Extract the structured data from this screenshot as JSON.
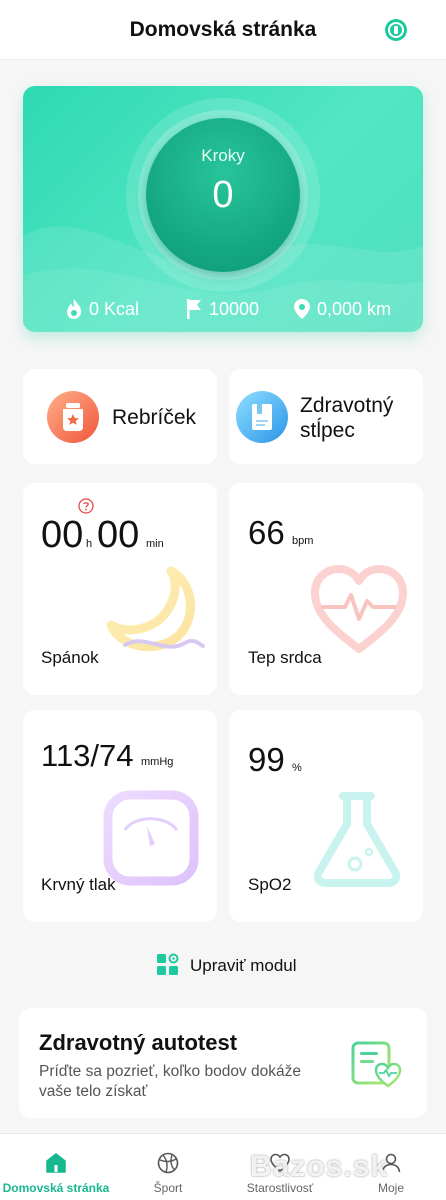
{
  "header": {
    "title": "Domovská stránka",
    "icon": "watch-sync-icon"
  },
  "hero": {
    "steps_label": "Kroky",
    "steps_value": "0",
    "stats": [
      {
        "icon": "flame-icon",
        "text": "0 Kcal"
      },
      {
        "icon": "flag-icon",
        "text": "10000"
      },
      {
        "icon": "location-pin-icon",
        "text": "0,000 km"
      }
    ]
  },
  "quick": {
    "leaderboard": {
      "label": "Rebríček",
      "icon": "trophy-icon"
    },
    "health_column": {
      "label_line1": "Zdravotný",
      "label_line2": "stĺpec",
      "icon": "notebook-icon"
    }
  },
  "metrics": {
    "sleep": {
      "hours": "00",
      "hours_unit": "h",
      "minutes": "00",
      "minutes_unit": "min",
      "title": "Spánok",
      "help_icon": "question-icon"
    },
    "heart": {
      "value": "66",
      "unit": "bpm",
      "title": "Tep srdca"
    },
    "pressure": {
      "value": "113/74",
      "unit": "mmHg",
      "title": "Krvný tlak"
    },
    "spo2": {
      "value": "99",
      "unit": "%",
      "title": "SpO2"
    }
  },
  "edit_module": {
    "label": "Upraviť modul",
    "icon": "grid-settings-icon"
  },
  "self_test": {
    "title": "Zdravotný autotest",
    "description": "Príďte sa pozrieť, koľko bodov dokáže vaše telo získať",
    "icon": "health-report-icon"
  },
  "bottom_nav": [
    {
      "label": "Domovská stránka",
      "icon": "home-icon",
      "active": true
    },
    {
      "label": "Šport",
      "icon": "ball-icon",
      "active": false
    },
    {
      "label": "Starostlivosť",
      "icon": "heart-outline-icon",
      "active": false
    },
    {
      "label": "Moje",
      "icon": "user-icon",
      "active": false
    }
  ],
  "watermark": "Bazos.sk",
  "colors": {
    "accent": "#1ec9a0",
    "hero_start": "#2fd9b3",
    "hero_end": "#4fe0bf",
    "nav_active": "#17b890"
  }
}
